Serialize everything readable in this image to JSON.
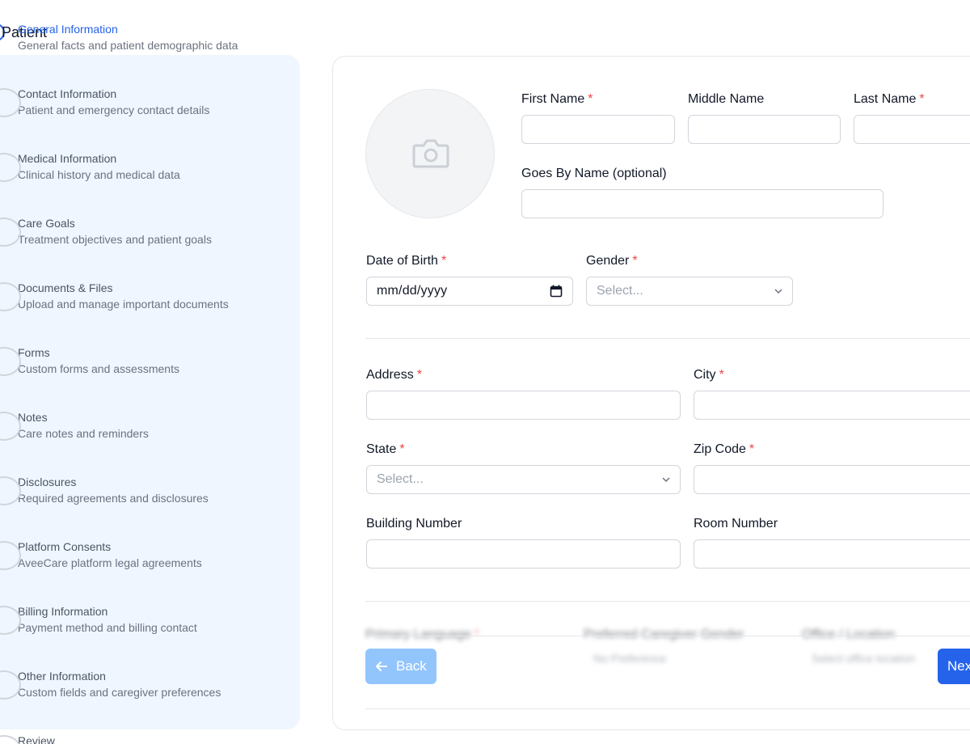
{
  "page": {
    "title": "Patient"
  },
  "steps": [
    {
      "title": "General Information",
      "description": "General facts and patient demographic data",
      "active": true
    },
    {
      "title": "Contact Information",
      "description": "Patient and emergency contact details"
    },
    {
      "title": "Medical Information",
      "description": "Clinical history and medical data"
    },
    {
      "title": "Care Goals",
      "description": "Treatment objectives and patient goals"
    },
    {
      "title": "Documents & Files",
      "description": "Upload and manage important documents"
    },
    {
      "title": "Forms",
      "description": "Custom forms and assessments"
    },
    {
      "title": "Notes",
      "description": "Care notes and reminders"
    },
    {
      "title": "Disclosures",
      "description": "Required agreements and disclosures"
    },
    {
      "title": "Platform Consents",
      "description": "AveeCare platform legal agreements"
    },
    {
      "title": "Billing Information",
      "description": "Payment method and billing contact"
    },
    {
      "title": "Other Information",
      "description": "Custom fields and caregiver preferences"
    },
    {
      "title": "Review",
      "description": ""
    }
  ],
  "form": {
    "first_name": {
      "label": "First Name",
      "required": "*",
      "value": ""
    },
    "middle_name": {
      "label": "Middle Name",
      "value": ""
    },
    "last_name": {
      "label": "Last Name",
      "required": "*",
      "value": ""
    },
    "goes_by": {
      "label": "Goes By Name (optional)",
      "value": ""
    },
    "dob": {
      "label": "Date of Birth",
      "required": "*",
      "placeholder": "mm/dd/yyyy"
    },
    "gender": {
      "label": "Gender",
      "required": "*",
      "placeholder": "Select..."
    },
    "address": {
      "label": "Address",
      "required": "*",
      "value": ""
    },
    "city": {
      "label": "City",
      "required": "*",
      "value": ""
    },
    "state": {
      "label": "State",
      "required": "*",
      "placeholder": "Select..."
    },
    "zip": {
      "label": "Zip Code",
      "required": "*",
      "value": ""
    },
    "building": {
      "label": "Building Number",
      "value": ""
    },
    "room": {
      "label": "Room Number",
      "value": ""
    },
    "obscured": {
      "primary_language": "Primary Language",
      "required": "*",
      "preferred_caregiver": "Preferred Caregiver Gender",
      "office": "Office / Location",
      "no_preference": "No Preference",
      "select_office": "Select office location"
    }
  },
  "buttons": {
    "back": "Back",
    "next": "Next"
  },
  "colors": {
    "accent": "#2563eb",
    "accent_light": "#93c5fd",
    "sidebar_bg": "#eff6ff",
    "required": "#ef4444"
  }
}
